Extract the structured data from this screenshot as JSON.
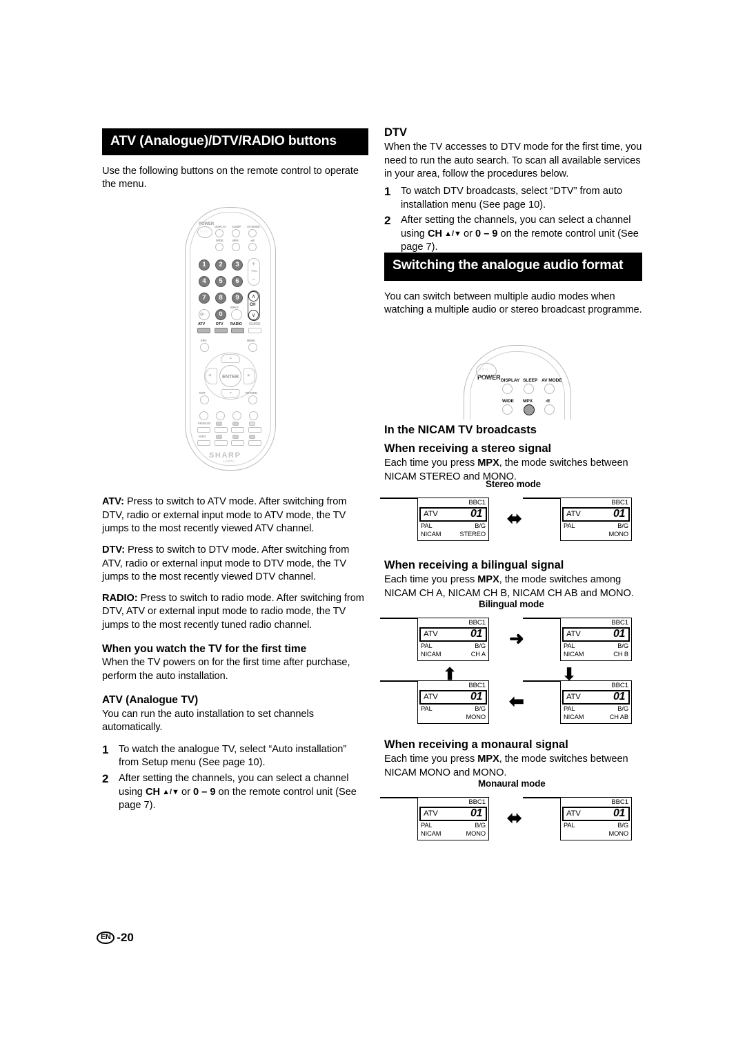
{
  "page": {
    "number": "-20",
    "lang_badge": "EN"
  },
  "left_column": {
    "heading": "ATV (Analogue)/DTV/RADIO buttons",
    "intro": "Use the following buttons on the remote control to operate the menu.",
    "definitions": [
      {
        "term": "ATV:",
        "text": " Press to switch to ATV mode. After switching from DTV, radio or external input mode to ATV mode, the TV jumps to the most recently viewed ATV channel."
      },
      {
        "term": "DTV:",
        "text": " Press to switch to DTV mode. After switching from ATV, radio or external input mode to DTV mode, the TV jumps to the most recently viewed DTV channel."
      },
      {
        "term": "RADIO:",
        "text": " Press to switch to radio mode. After switching from DTV, ATV or external input mode to radio mode, the TV jumps to the most recently tuned radio channel."
      }
    ],
    "first_time": {
      "heading": "When you watch the TV for the first time",
      "text": "When the TV powers on for the first time after purchase, perform the auto installation."
    },
    "atv_analogue": {
      "heading": "ATV (Analogue TV)",
      "text": "You can run the auto installation to set channels automatically.",
      "steps": [
        {
          "num": "1",
          "parts": [
            {
              "t": "To watch the analogue TV, select “Auto installation” from Setup menu (See page 10).",
              "bold": false
            }
          ]
        },
        {
          "num": "2",
          "parts": [
            {
              "t": "After setting the channels, you can select a channel using ",
              "bold": false
            },
            {
              "t": "CH",
              "bold": true
            },
            {
              "t": " ▲/▼ ",
              "bold": true
            },
            {
              "t": "or ",
              "bold": false
            },
            {
              "t": "0 – 9",
              "bold": true
            },
            {
              "t": " on the remote control unit (See page 7).",
              "bold": false
            }
          ]
        }
      ]
    }
  },
  "right_column": {
    "dtv": {
      "heading": "DTV",
      "text": "When the TV accesses to DTV mode for the first time, you need to run the auto search. To scan all available services in your area, follow the procedures below.",
      "steps": [
        {
          "num": "1",
          "parts": [
            {
              "t": "To watch DTV broadcasts, select “DTV” from auto installation menu (See page 10).",
              "bold": false
            }
          ]
        },
        {
          "num": "2",
          "parts": [
            {
              "t": "After setting the channels, you can select a channel using ",
              "bold": false
            },
            {
              "t": "CH",
              "bold": true
            },
            {
              "t": " ▲/▼ ",
              "bold": true
            },
            {
              "t": "or ",
              "bold": false
            },
            {
              "t": "0 – 9",
              "bold": true
            },
            {
              "t": " on the remote control unit (See page 7).",
              "bold": false
            }
          ]
        }
      ]
    },
    "switching": {
      "heading": "Switching the analogue audio format",
      "text": "You can switch between multiple audio modes when watching a multiple audio or stereo broadcast programme."
    },
    "nicam": {
      "heading": "In the NICAM TV broadcasts",
      "stereo": {
        "heading": "When receiving a stereo signal",
        "text_pre": "Each time you press ",
        "text_key": "MPX",
        "text_post": ", the mode switches between NICAM STEREO and MONO.",
        "diagram_title": "Stereo mode"
      },
      "bilingual": {
        "heading": "When receiving a bilingual signal",
        "text_pre": "Each time you press ",
        "text_key": "MPX",
        "text_post": ", the mode switches among NICAM CH A, NICAM CH B, NICAM CH AB and MONO.",
        "diagram_title": "Bilingual mode"
      },
      "monaural": {
        "heading": "When receiving a monaural signal",
        "text_pre": "Each time you press ",
        "text_key": "MPX",
        "text_post": ", the mode switches between NICAM MONO and MONO.",
        "diagram_title": "Monaural mode"
      }
    }
  },
  "osd_screens": {
    "stereo_1": {
      "channel_name": "BBC1",
      "source": "ATV",
      "number": "01",
      "row1_left": "PAL",
      "row1_right": "B/G",
      "row2_left": "NICAM",
      "row2_right": "STEREO"
    },
    "stereo_2": {
      "channel_name": "BBC1",
      "source": "ATV",
      "number": "01",
      "row1_left": "PAL",
      "row1_right": "B/G",
      "row2_left": "",
      "row2_right": "MONO"
    },
    "bilingual_a": {
      "channel_name": "BBC1",
      "source": "ATV",
      "number": "01",
      "row1_left": "PAL",
      "row1_right": "B/G",
      "row2_left": "NICAM",
      "row2_right": "CH A"
    },
    "bilingual_b": {
      "channel_name": "BBC1",
      "source": "ATV",
      "number": "01",
      "row1_left": "PAL",
      "row1_right": "B/G",
      "row2_left": "NICAM",
      "row2_right": "CH B"
    },
    "bilingual_ab": {
      "channel_name": "BBC1",
      "source": "ATV",
      "number": "01",
      "row1_left": "PAL",
      "row1_right": "B/G",
      "row2_left": "NICAM",
      "row2_right": "CH AB"
    },
    "bilingual_mono": {
      "channel_name": "BBC1",
      "source": "ATV",
      "number": "01",
      "row1_left": "PAL",
      "row1_right": "B/G",
      "row2_left": "",
      "row2_right": "MONO"
    },
    "monaural_1": {
      "channel_name": "BBC1",
      "source": "ATV",
      "number": "01",
      "row1_left": "PAL",
      "row1_right": "B/G",
      "row2_left": "NICAM",
      "row2_right": "MONO"
    },
    "monaural_2": {
      "channel_name": "BBC1",
      "source": "ATV",
      "number": "01",
      "row1_left": "PAL",
      "row1_right": "B/G",
      "row2_left": "",
      "row2_right": "MONO"
    }
  },
  "arrows": {
    "double_horizontal": "⬌",
    "right": "➜",
    "down": "⬇",
    "left": "⬅",
    "up": "⬆"
  },
  "remote_full": {
    "brand": "SHARP",
    "brand_sub": "LCDTV",
    "power_label": "POWER",
    "top_labels": [
      "DISPLAY",
      "SLEEP",
      "AV MODE",
      "WIDE",
      "MPX",
      "‹E"
    ],
    "numbers": [
      "1",
      "2",
      "3",
      "4",
      "5",
      "6",
      "7",
      "8",
      "9",
      "0"
    ],
    "vol_label": "VOL",
    "ch_label": "CH",
    "input_label": "INPUT",
    "mode_keys": [
      "ATV",
      "DTV",
      "RADIO",
      "GUIDE"
    ],
    "nav_labels": [
      "EPG",
      "MENU",
      "EXIT",
      "RETURN",
      "ENTER"
    ],
    "bottom_labels": [
      "FREEZE",
      "INFO"
    ]
  },
  "remote_top": {
    "power_label": "POWER",
    "row1": [
      "DISPLAY",
      "SLEEP",
      "AV MODE"
    ],
    "row2": [
      "WIDE",
      "MPX",
      "‹E"
    ],
    "highlight_key": "MPX"
  }
}
